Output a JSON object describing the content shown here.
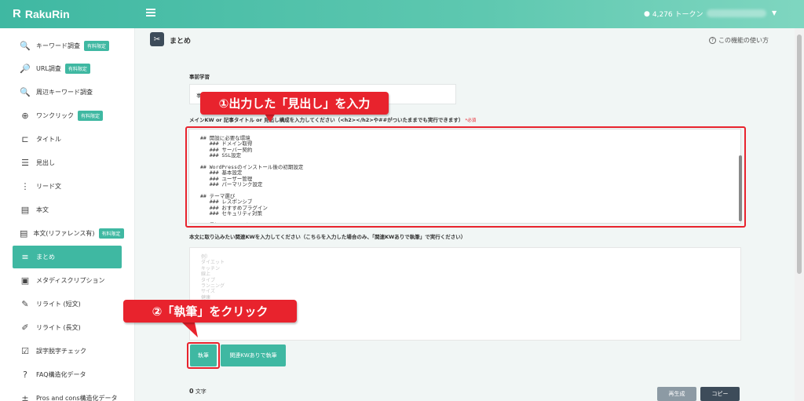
{
  "header": {
    "logo": "RakuRin",
    "tokens": "4,276 トークン"
  },
  "sidebar": {
    "items": [
      {
        "label": "キーワード調査",
        "badge": "有料限定",
        "icon": "keyword-search-icon",
        "glyph": "🔍"
      },
      {
        "label": "URL調査",
        "badge": "有料限定",
        "icon": "url-search-icon",
        "glyph": "🔎"
      },
      {
        "label": "周辺キーワード調査",
        "badge": "",
        "icon": "related-keyword-icon",
        "glyph": "🔍"
      },
      {
        "label": "ワンクリック",
        "badge": "有料限定",
        "icon": "one-click-icon",
        "glyph": "⊕"
      },
      {
        "label": "タイトル",
        "badge": "",
        "icon": "title-icon",
        "glyph": "⊏"
      },
      {
        "label": "見出し",
        "badge": "",
        "icon": "heading-icon",
        "glyph": "☰"
      },
      {
        "label": "リード文",
        "badge": "",
        "icon": "lead-icon",
        "glyph": "⋮"
      },
      {
        "label": "本文",
        "badge": "",
        "icon": "body-icon",
        "glyph": "▤"
      },
      {
        "label": "本文(リファレンス有)",
        "badge": "有料限定",
        "icon": "body-reference-icon",
        "glyph": "▤"
      },
      {
        "label": "まとめ",
        "badge": "",
        "icon": "summary-icon",
        "glyph": "≡"
      },
      {
        "label": "メタディスクリプション",
        "badge": "",
        "icon": "meta-description-icon",
        "glyph": "▣"
      },
      {
        "label": "リライト (短文)",
        "badge": "",
        "icon": "rewrite-short-icon",
        "glyph": "✎"
      },
      {
        "label": "リライト (長文)",
        "badge": "",
        "icon": "rewrite-long-icon",
        "glyph": "✐"
      },
      {
        "label": "誤字脱字チェック",
        "badge": "",
        "icon": "typo-check-icon",
        "glyph": "☑"
      },
      {
        "label": "FAQ構造化データ",
        "badge": "",
        "icon": "faq-icon",
        "glyph": "?"
      },
      {
        "label": "Pros and cons構造化データ",
        "badge": "",
        "icon": "pros-cons-icon",
        "glyph": "±"
      }
    ]
  },
  "main": {
    "title": "まとめ",
    "help": "この機能の使い方",
    "pre_label": "事前学習",
    "pre_value": "事",
    "kw_label": "メインKW or 記事タイトル or 見出し構成を入力してください（<h2></h2>や##がついたままでも実行できます）",
    "required": "*必須",
    "kw_lines": [
      "## 開設に必要な環境",
      "   ### ドメイン取得",
      "   ### サーバー契約",
      "   ### SSL設定",
      "",
      "## WordPressのインストール後の初期設定",
      "   ### 基本設定",
      "   ### ユーザー管理",
      "   ### パーマリンク設定",
      "",
      "## テーマ選び",
      "   ### レスポンシブ",
      "   ### おすすめプラグイン",
      "   ### セキュリティ対策",
      "",
      "## 最短で公開するためのチェックリスト"
    ],
    "rel_label": "本文に取り込みたい関連KWを入力してください（こちらを入力した場合のみ、「関連KWありで執筆」で実行ください）",
    "rel_placeholder": [
      "例）",
      "ダイエット",
      "キッチン",
      "線上",
      "タイプ",
      "ランニング",
      "サイズ",
      "健康"
    ],
    "write_button": "執筆",
    "write_kw_button": "関連KWありで執筆",
    "char_count": "0",
    "char_unit": "文字",
    "regen_button": "再生成",
    "copy_button": "コピー"
  },
  "annotations": {
    "callout1": "①出力した「見出し」を入力",
    "callout2": "②「執筆」をクリック",
    "color": "#e8232d"
  }
}
